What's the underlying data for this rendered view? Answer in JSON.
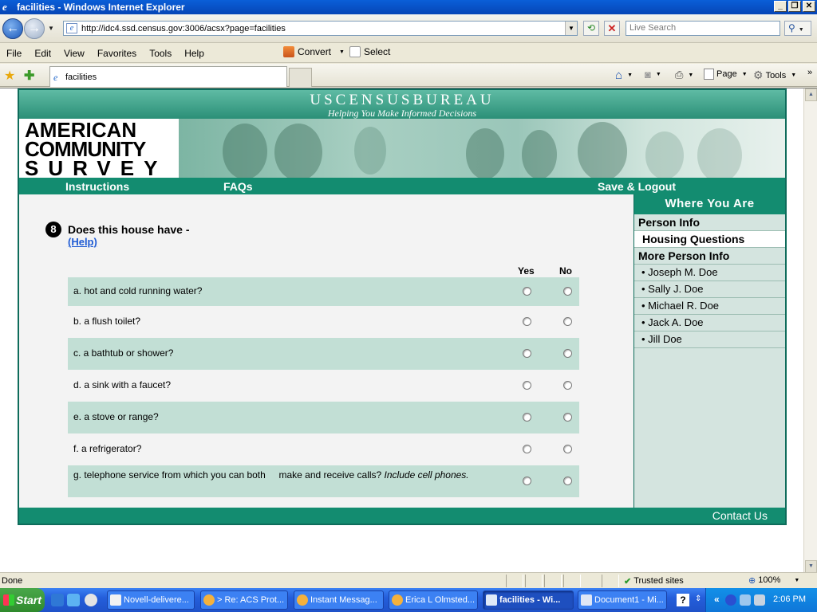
{
  "window": {
    "title": "facilities - Windows Internet Explorer",
    "url": "http://idc4.ssd.census.gov:3006/acsx?page=facilities",
    "search_placeholder": "Live Search"
  },
  "menu": {
    "items": [
      "File",
      "Edit",
      "View",
      "Favorites",
      "Tools",
      "Help"
    ],
    "convert": "Convert",
    "select": "Select"
  },
  "favbar": {
    "tab_label": "facilities",
    "page": "Page",
    "tools": "Tools"
  },
  "site": {
    "bureau": "USCENSUSBUREAU",
    "tagline": "Helping You Make Informed Decisions",
    "logo_line1": "AMERICAN",
    "logo_line2": "COMMUNITY",
    "logo_line3": "SURVEY",
    "nav": {
      "instructions": "Instructions",
      "faqs": "FAQs",
      "save_logout": "Save & Logout"
    },
    "contact": "Contact Us"
  },
  "question": {
    "number": "8",
    "text": "Does this house have -",
    "help": "(Help)",
    "col_yes": "Yes",
    "col_no": "No",
    "items": [
      {
        "label": "a. hot and cold running water?",
        "yes": false,
        "no": false
      },
      {
        "label": "b. a flush toilet?",
        "yes": false,
        "no": false
      },
      {
        "label": "c. a bathtub or shower?",
        "yes": false,
        "no": false
      },
      {
        "label": "d. a sink with a faucet?",
        "yes": false,
        "no": false
      },
      {
        "label": "e. a stove or range?",
        "yes": false,
        "no": false
      },
      {
        "label": "f. a refrigerator?",
        "yes": false,
        "no": false
      },
      {
        "label": "g. telephone service from which you can both     make and receive calls?",
        "label_italic": "Include cell phones.",
        "yes": false,
        "no": false
      }
    ]
  },
  "sidebar": {
    "heading": "Where You Are",
    "sections": [
      {
        "label": "Person Info",
        "style": "bold"
      },
      {
        "label": "Housing Questions",
        "style": "current"
      },
      {
        "label": "More Person Info",
        "style": "bold"
      }
    ],
    "people": [
      "• Joseph M. Doe",
      "• Sally J. Doe",
      "• Michael R. Doe",
      "• Jack A. Doe",
      "• Jill Doe"
    ]
  },
  "status": {
    "text": "Done",
    "zone": "Trusted sites",
    "zoom": "100%"
  },
  "taskbar": {
    "start": "Start",
    "tasks": [
      "Novell-delivere...",
      "> Re: ACS Prot...",
      "Instant Messag...",
      "Erica L Olmsted...",
      "facilities - Wi...",
      "Document1 - Mi..."
    ],
    "clock": "2:06 PM"
  }
}
